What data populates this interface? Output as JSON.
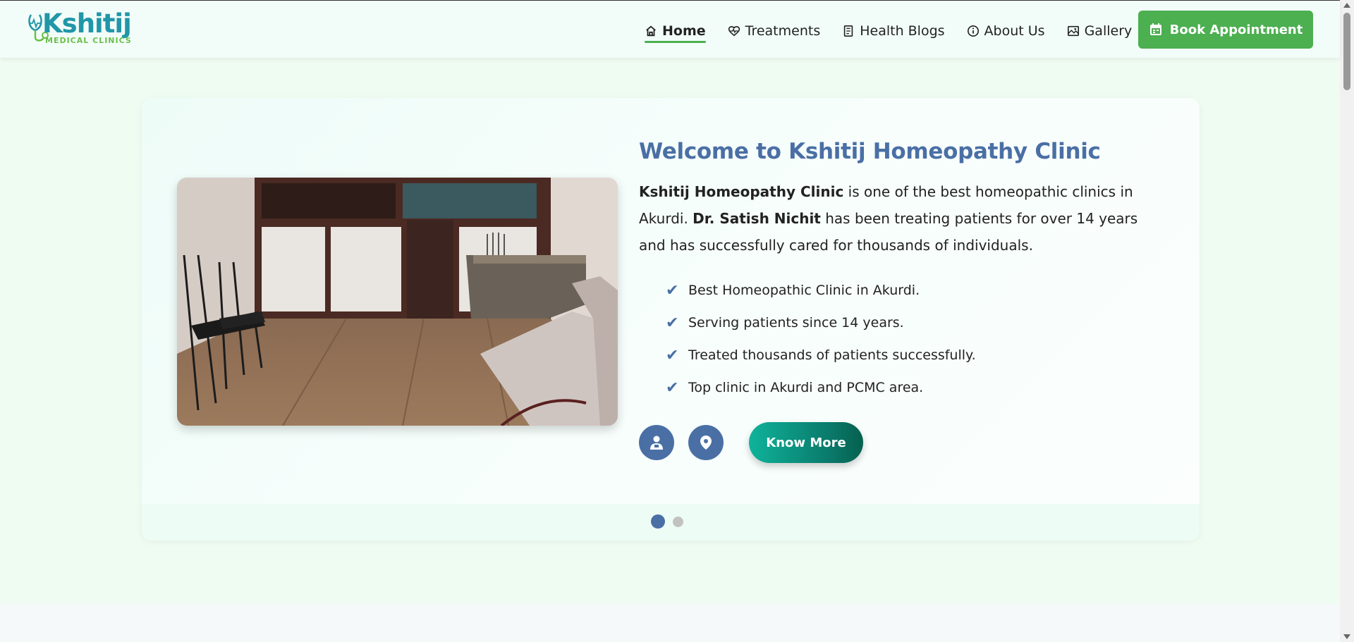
{
  "brand": {
    "name": "Kshitij",
    "tagline": "MEDICAL CLINICS"
  },
  "nav": {
    "items": [
      {
        "label": "Home",
        "icon": "home-icon",
        "active": true
      },
      {
        "label": "Treatments",
        "icon": "heart-pulse-icon",
        "active": false
      },
      {
        "label": "Health Blogs",
        "icon": "document-icon",
        "active": false
      },
      {
        "label": "About Us",
        "icon": "info-icon",
        "active": false
      },
      {
        "label": "Gallery",
        "icon": "gallery-icon",
        "active": false
      }
    ],
    "cta_label": "Book Appointment",
    "cta_icon": "calendar-icon"
  },
  "hero": {
    "heading": "Welcome to Kshitij Homeopathy Clinic",
    "intro": {
      "clinic_name": "Kshitij Homeopathy Clinic",
      "text_1": " is one of the best homeopathic clinics in Akurdi. ",
      "doctor_name": "Dr. Satish Nichit",
      "text_2": " has been treating patients for over 14 years and has successfully cared for thousands of individuals."
    },
    "features": [
      "Best Homeopathic Clinic in Akurdi.",
      "Serving patients since 14 years.",
      "Treated thousands of patients successfully.",
      "Top clinic in Akurdi and PCMC area."
    ],
    "know_more_label": "Know More",
    "action_icons": [
      "doctor-icon",
      "location-pin-icon"
    ],
    "slides": {
      "count": 2,
      "active": 1
    }
  },
  "colors": {
    "accent_green": "#4caf50",
    "heading_blue": "#4a6fa5",
    "teal": "#0fb39a"
  }
}
